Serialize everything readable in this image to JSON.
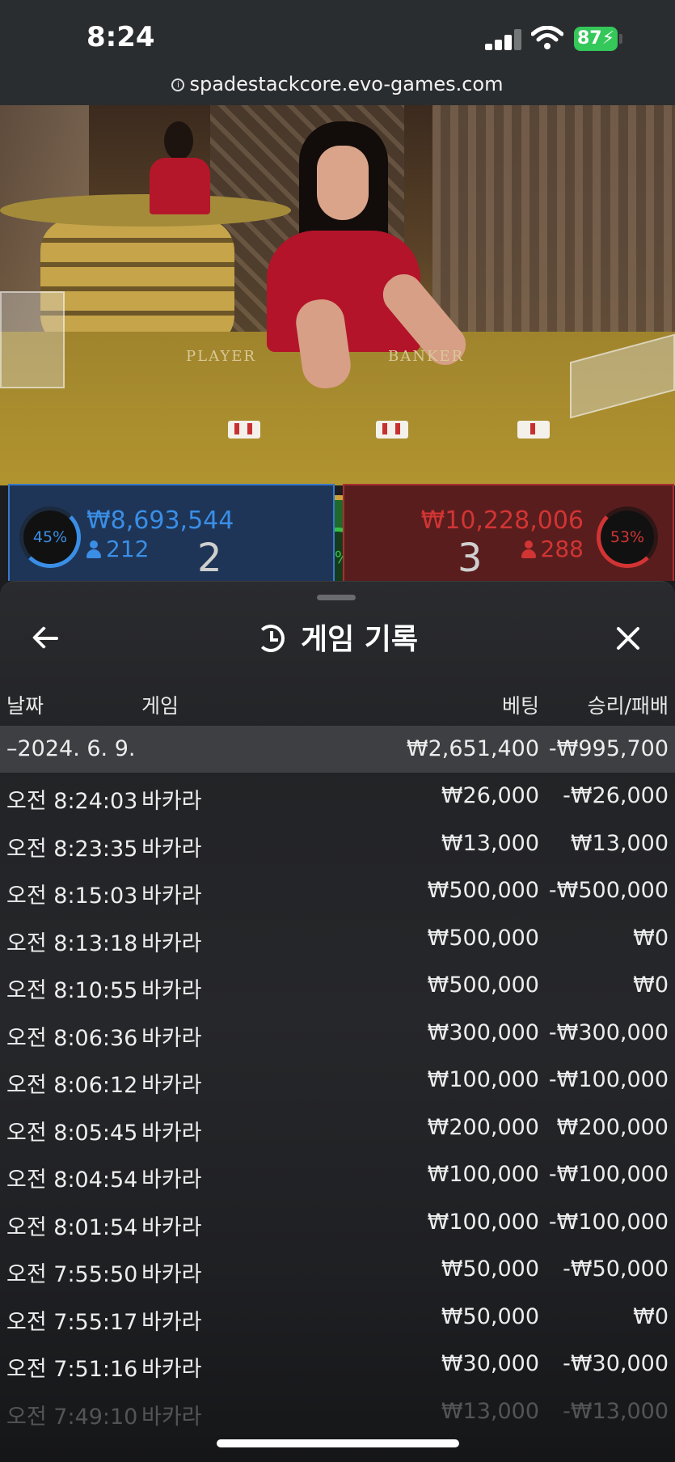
{
  "status_bar": {
    "time": "8:24",
    "battery": "87"
  },
  "browser": {
    "url": "spadestackcore.evo-games.com"
  },
  "table": {
    "felt_player_label": "PLAYER",
    "felt_banker_label": "BANKER",
    "player": {
      "percent": "45%",
      "amount": "₩8,693,544",
      "players": "212",
      "score": "2"
    },
    "banker": {
      "percent": "53%",
      "amount": "₩10,228,006",
      "players": "288",
      "score": "3"
    },
    "tie": {
      "percent": "2%"
    }
  },
  "history": {
    "title": "게임 기록",
    "columns": {
      "date": "날짜",
      "game": "게임",
      "bet": "베팅",
      "win_loss": "승리/패배"
    },
    "day": {
      "date": "–2024. 6. 9.",
      "bet_total": "₩2,651,400",
      "win_total": "-₩995,700"
    },
    "rows": [
      {
        "time": "오전 8:24:03",
        "game": "바카라",
        "bet": "₩26,000",
        "result": "-₩26,000"
      },
      {
        "time": "오전 8:23:35",
        "game": "바카라",
        "bet": "₩13,000",
        "result": "₩13,000"
      },
      {
        "time": "오전 8:15:03",
        "game": "바카라",
        "bet": "₩500,000",
        "result": "-₩500,000"
      },
      {
        "time": "오전 8:13:18",
        "game": "바카라",
        "bet": "₩500,000",
        "result": "₩0"
      },
      {
        "time": "오전 8:10:55",
        "game": "바카라",
        "bet": "₩500,000",
        "result": "₩0"
      },
      {
        "time": "오전 8:06:36",
        "game": "바카라",
        "bet": "₩300,000",
        "result": "-₩300,000"
      },
      {
        "time": "오전 8:06:12",
        "game": "바카라",
        "bet": "₩100,000",
        "result": "-₩100,000"
      },
      {
        "time": "오전 8:05:45",
        "game": "바카라",
        "bet": "₩200,000",
        "result": "₩200,000"
      },
      {
        "time": "오전 8:04:54",
        "game": "바카라",
        "bet": "₩100,000",
        "result": "-₩100,000"
      },
      {
        "time": "오전 8:01:54",
        "game": "바카라",
        "bet": "₩100,000",
        "result": "-₩100,000"
      },
      {
        "time": "오전 7:55:50",
        "game": "바카라",
        "bet": "₩50,000",
        "result": "-₩50,000"
      },
      {
        "time": "오전 7:55:17",
        "game": "바카라",
        "bet": "₩50,000",
        "result": "₩0"
      },
      {
        "time": "오전 7:51:16",
        "game": "바카라",
        "bet": "₩30,000",
        "result": "-₩30,000"
      },
      {
        "time": "오전 7:49:10",
        "game": "바카라",
        "bet": "₩13,000",
        "result": "-₩13,000"
      }
    ]
  }
}
